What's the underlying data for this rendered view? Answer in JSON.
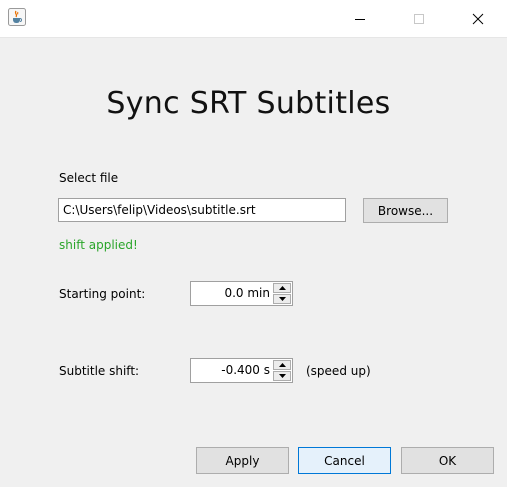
{
  "window": {
    "title": "",
    "heading": "Sync SRT Subtitles"
  },
  "file": {
    "label": "Select file",
    "path": "C:\\Users\\felip\\Videos\\subtitle.srt",
    "browse_label": "Browse...",
    "status": "shift applied!"
  },
  "starting_point": {
    "label": "Starting point:",
    "value": "0.0 min"
  },
  "subtitle_shift": {
    "label": "Subtitle shift:",
    "value": "-0.400 s",
    "note": "(speed up)"
  },
  "buttons": {
    "apply": "Apply",
    "cancel": "Cancel",
    "ok": "OK"
  },
  "colors": {
    "status_green": "#2aa52a",
    "focus_blue": "#0078d7"
  },
  "icons": {
    "app": "java-coffee-cup-icon",
    "minimize": "minimize-icon",
    "maximize": "maximize-icon",
    "close": "close-icon"
  }
}
